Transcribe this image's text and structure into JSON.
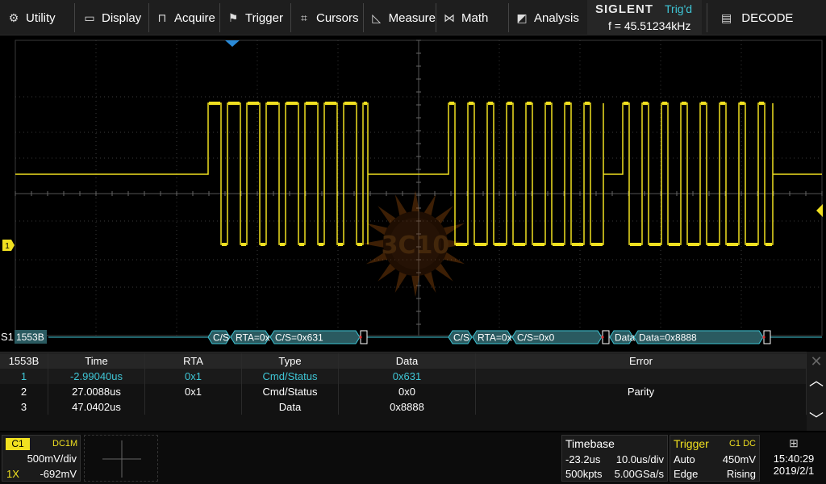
{
  "menu": {
    "items": [
      {
        "label": "Utility",
        "icon": "gear-icon"
      },
      {
        "label": "Display",
        "icon": "monitor-icon"
      },
      {
        "label": "Acquire",
        "icon": "acquire-icon"
      },
      {
        "label": "Trigger",
        "icon": "flag-icon"
      },
      {
        "label": "Cursors",
        "icon": "cursors-icon"
      },
      {
        "label": "Measure",
        "icon": "measure-icon"
      },
      {
        "label": "Math",
        "icon": "math-icon"
      },
      {
        "label": "Analysis",
        "icon": "analysis-icon"
      }
    ],
    "brand": "SIGLENT",
    "trig_status": "Trig'd",
    "frequency": "f = 45.51234kHz",
    "decode_label": "DECODE"
  },
  "bus": {
    "name": "S1",
    "protocol_tag": "1553B",
    "frames": [
      [
        "C/S",
        "RTA=0x",
        "C/S=0x631"
      ],
      [
        "C/S",
        "RTA=0x",
        "C/S=0x0"
      ],
      [
        "Data",
        "Data=0x8888"
      ]
    ]
  },
  "channel_marker": "1",
  "watermark": "3C10",
  "decode_table": {
    "headers": [
      "1553B",
      "Time",
      "RTA",
      "Type",
      "Data",
      "Error"
    ],
    "rows": [
      [
        "1",
        "-2.99040us",
        "0x1",
        "Cmd/Status",
        "0x631",
        ""
      ],
      [
        "2",
        "27.0088us",
        "0x1",
        "Cmd/Status",
        "0x0",
        "Parity"
      ],
      [
        "3",
        "47.0402us",
        "",
        "Data",
        "0x8888",
        ""
      ]
    ],
    "selected_row": 0
  },
  "channel": {
    "name": "C1",
    "coupling": "DC1M",
    "volts_div": "500mV/div",
    "probe": "1X",
    "offset": "-692mV"
  },
  "timebase": {
    "title": "Timebase",
    "delay": "-23.2us",
    "time_div": "10.0us/div",
    "memory": "500kpts",
    "sample_rate": "5.00GSa/s"
  },
  "trigger": {
    "title": "Trigger",
    "source": "C1 DC",
    "mode": "Auto",
    "level": "450mV",
    "type": "Edge",
    "slope": "Rising"
  },
  "clock": {
    "time": "15:40:29",
    "date": "2019/2/1"
  },
  "colors": {
    "trace": "#f0e020",
    "accent": "#3fc6d6",
    "bus_fill": "#2a5a60"
  }
}
